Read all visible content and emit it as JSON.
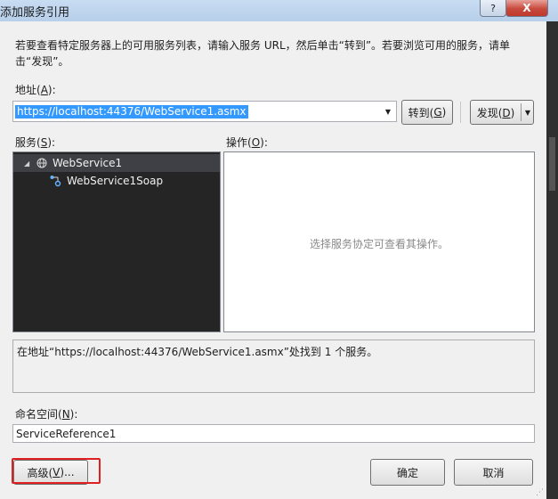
{
  "window": {
    "title": "添加服务引用",
    "help_label": "?",
    "close_label": "X"
  },
  "description": "若要查看特定服务器上的可用服务列表，请输入服务 URL，然后单击“转到”。若要浏览可用的服务，请单击“发现”。",
  "address": {
    "label_prefix": "地址(",
    "label_key": "A",
    "label_suffix": "):",
    "value": "https://localhost:44376/WebService1.asmx"
  },
  "buttons": {
    "go_prefix": "转到(",
    "go_key": "G",
    "go_suffix": ")",
    "discover_prefix": "发现(",
    "discover_key": "D",
    "discover_suffix": ")",
    "advanced_prefix": "高级(",
    "advanced_key": "V",
    "advanced_suffix": ")...",
    "ok": "确定",
    "cancel": "取消"
  },
  "services": {
    "label_prefix": "服务(",
    "label_key": "S",
    "label_suffix": "):",
    "tree": [
      {
        "label": "WebService1",
        "expanded": true,
        "selected": true,
        "icon": "globe-icon"
      },
      {
        "label": "WebService1Soap",
        "icon": "endpoint-icon"
      }
    ]
  },
  "operations": {
    "label_prefix": "操作(",
    "label_key": "O",
    "label_suffix": "):",
    "hint": "选择服务协定可查看其操作。"
  },
  "status": {
    "text": "在地址“https://localhost:44376/WebService1.asmx”处找到 1 个服务。"
  },
  "namespace": {
    "label_prefix": "命名空间(",
    "label_key": "N",
    "label_suffix": "):",
    "value": "ServiceReference1"
  },
  "colors": {
    "selection": "#3399ff",
    "tree_background": "#252526",
    "highlight_box": "#e02020"
  }
}
